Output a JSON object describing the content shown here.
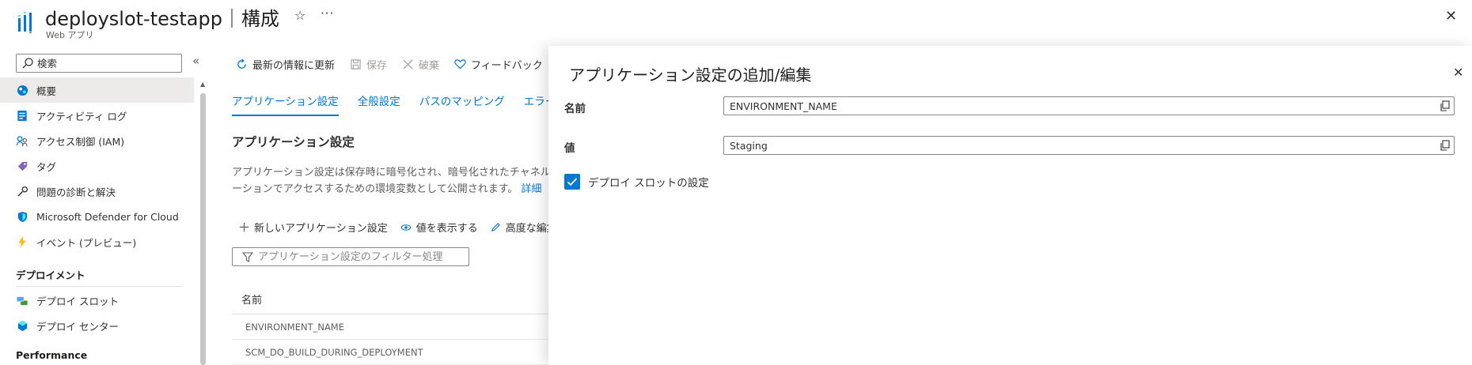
{
  "header": {
    "title": "deployslot-testapp｜構成",
    "subtitle": "Web アプリ",
    "star_glyph": "☆",
    "more_glyph": "···",
    "close_glyph": "✕"
  },
  "sidebar": {
    "search_placeholder": "検索",
    "collapse_glyph": "«",
    "items": [
      {
        "label": "概要",
        "icon": "overview-icon",
        "active": true
      },
      {
        "label": "アクティビティ ログ",
        "icon": "activity-log-icon"
      },
      {
        "label": "アクセス制御 (IAM)",
        "icon": "iam-icon"
      },
      {
        "label": "タグ",
        "icon": "tag-icon"
      },
      {
        "label": "問題の診断と解決",
        "icon": "wrench-icon"
      },
      {
        "label": "Microsoft Defender for Cloud",
        "icon": "defender-icon"
      },
      {
        "label": "イベント (プレビュー)",
        "icon": "lightning-icon"
      }
    ],
    "group_deploy": "デプロイメント",
    "deploy_items": [
      {
        "label": "デプロイ スロット",
        "icon": "deployment-slots-icon"
      },
      {
        "label": "デプロイ センター",
        "icon": "deployment-center-icon"
      }
    ],
    "group_performance": "Performance"
  },
  "toolbar": {
    "refresh": "最新の情報に更新",
    "save": "保存",
    "discard": "破棄",
    "feedback": "フィードバック"
  },
  "tabs": [
    "アプリケーション設定",
    "全般設定",
    "パスのマッピング",
    "エラー ページ"
  ],
  "section": {
    "title": "アプリケーション設定",
    "desc_line1": "アプリケーション設定は保存時に暗号化され、暗号化されたチャネル経由でアプリケーションに公開されます。",
    "desc_line2": "ーションでアクセスするための環境変数として公開されます。",
    "desc_link": "詳細"
  },
  "actions": {
    "new_setting": "新しいアプリケーション設定",
    "show_values": "値を表示する",
    "advanced_edit": "高度な編集"
  },
  "filter_placeholder": "アプリケーション設定のフィルター処理",
  "table": {
    "col_name": "名前",
    "rows": [
      "ENVIRONMENT_NAME",
      "SCM_DO_BUILD_DURING_DEPLOYMENT"
    ]
  },
  "panel": {
    "title": "アプリケーション設定の追加/編集",
    "close_glyph": "✕",
    "name_label": "名前",
    "name_value": "ENVIRONMENT_NAME",
    "value_label": "値",
    "value_value": "Staging",
    "slot_setting_label": "デプロイ スロットの設定",
    "slot_setting_checked": true
  },
  "colors": {
    "accent": "#0078d4",
    "text": "#323130",
    "muted": "#605e5c",
    "border": "#8a8886"
  }
}
